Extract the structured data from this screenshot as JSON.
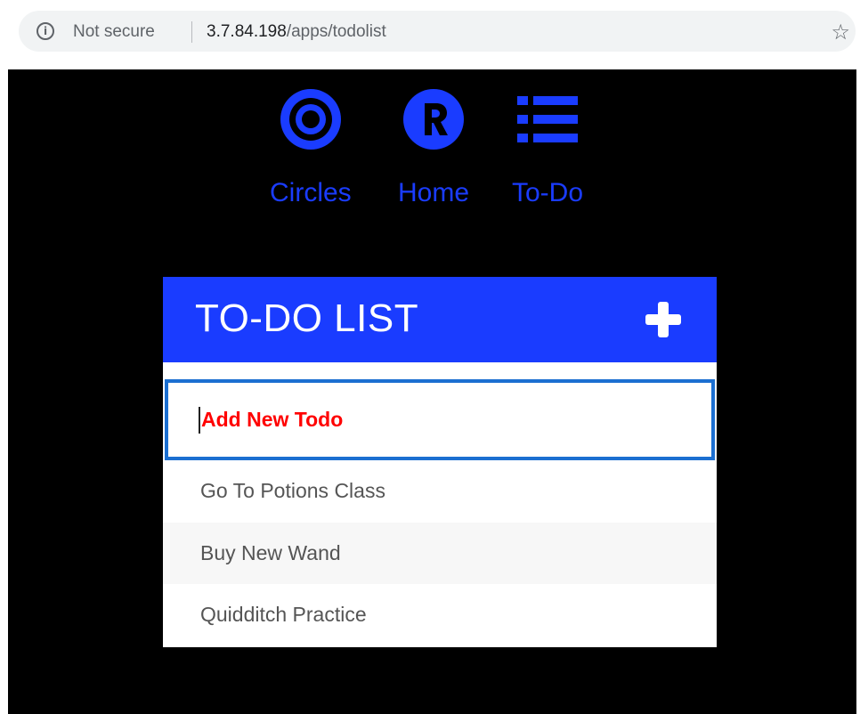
{
  "browser": {
    "security_label": "Not secure",
    "url_host": "3.7.84.198",
    "url_path": "/apps/todolist",
    "info_icon": "i",
    "bookmark_icon": "☆"
  },
  "nav": {
    "items": [
      {
        "label": "Circles",
        "icon": "circles-icon"
      },
      {
        "label": "Home",
        "icon": "r-logo-icon"
      },
      {
        "label": "To-Do",
        "icon": "list-icon"
      }
    ]
  },
  "todo": {
    "title": "TO-DO LIST",
    "input_value": "Add New Todo",
    "items": [
      "Go To Potions Class",
      "Buy New Wand",
      "Quidditch Practice"
    ]
  },
  "colors": {
    "accent": "#1a3cff",
    "background": "#000000",
    "input_border": "#1b6fd1",
    "input_text": "#ff0000"
  }
}
